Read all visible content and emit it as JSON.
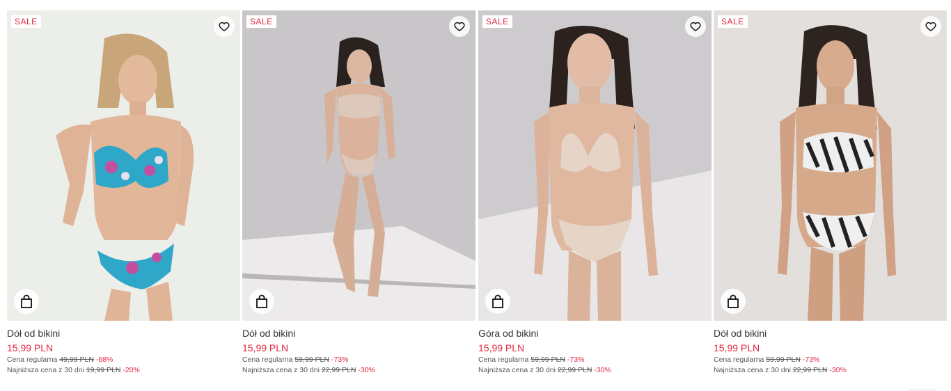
{
  "products": [
    {
      "badge": "SALE",
      "name": "Dół od bikini",
      "price": "15,99 PLN",
      "regular_label": "Cena regularna",
      "regular_price": "49,99 PLN",
      "regular_discount": "-68%",
      "lowest_label": "Najniższa cena z 30 dni",
      "lowest_price": "19,99 PLN",
      "lowest_discount": "-20%",
      "image": "model-floral-bikini"
    },
    {
      "badge": "SALE",
      "name": "Dół od bikini",
      "price": "15,99 PLN",
      "regular_label": "Cena regularna",
      "regular_price": "59,99 PLN",
      "regular_discount": "-73%",
      "lowest_label": "Najniższa cena z 30 dni",
      "lowest_price": "22,99 PLN",
      "lowest_discount": "-30%",
      "image": "model-beige-bikini-full"
    },
    {
      "badge": "SALE",
      "name": "Góra od bikini",
      "price": "15,99 PLN",
      "regular_label": "Cena regularna",
      "regular_price": "59,99 PLN",
      "regular_discount": "-73%",
      "lowest_label": "Najniższa cena z 30 dni",
      "lowest_price": "22,99 PLN",
      "lowest_discount": "-30%",
      "image": "model-beige-bikini"
    },
    {
      "badge": "SALE",
      "name": "Dół od bikini",
      "price": "15,99 PLN",
      "regular_label": "Cena regularna",
      "regular_price": "59,99 PLN",
      "regular_discount": "-73%",
      "lowest_label": "Najniższa cena z 30 dni",
      "lowest_price": "22,99 PLN",
      "lowest_discount": "-30%",
      "image": "model-zebra-bikini"
    }
  ],
  "icons": {
    "favorite": "heart-icon",
    "add_to_cart": "shopping-bag-icon"
  },
  "colors": {
    "sale": "#e2263f",
    "text": "#333333"
  }
}
